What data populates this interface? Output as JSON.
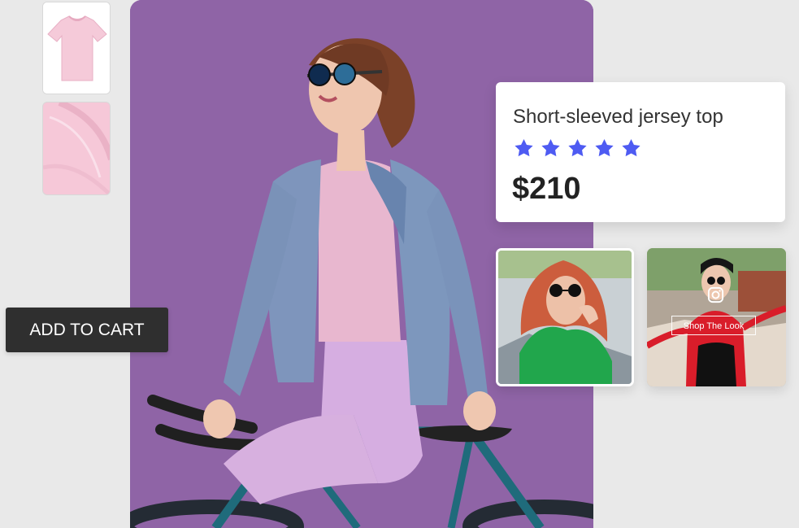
{
  "product": {
    "name": "Short-sleeved jersey top",
    "price": "$210",
    "rating": 5,
    "rating_max": 5
  },
  "actions": {
    "add_to_cart_label": "ADD TO CART"
  },
  "shop_the_look": {
    "label": "Shop The Look",
    "social_icon": "instagram-icon"
  },
  "icons": {
    "star": "star-icon",
    "social": "instagram-icon"
  },
  "colors": {
    "background": "#e9e9e9",
    "hero_background": "#8f64a6",
    "star": "#4e5bf2",
    "button_background": "#2f2f2f",
    "button_text": "#ffffff",
    "card_background": "#ffffff",
    "thumbnail_product": "#f5cad9"
  }
}
